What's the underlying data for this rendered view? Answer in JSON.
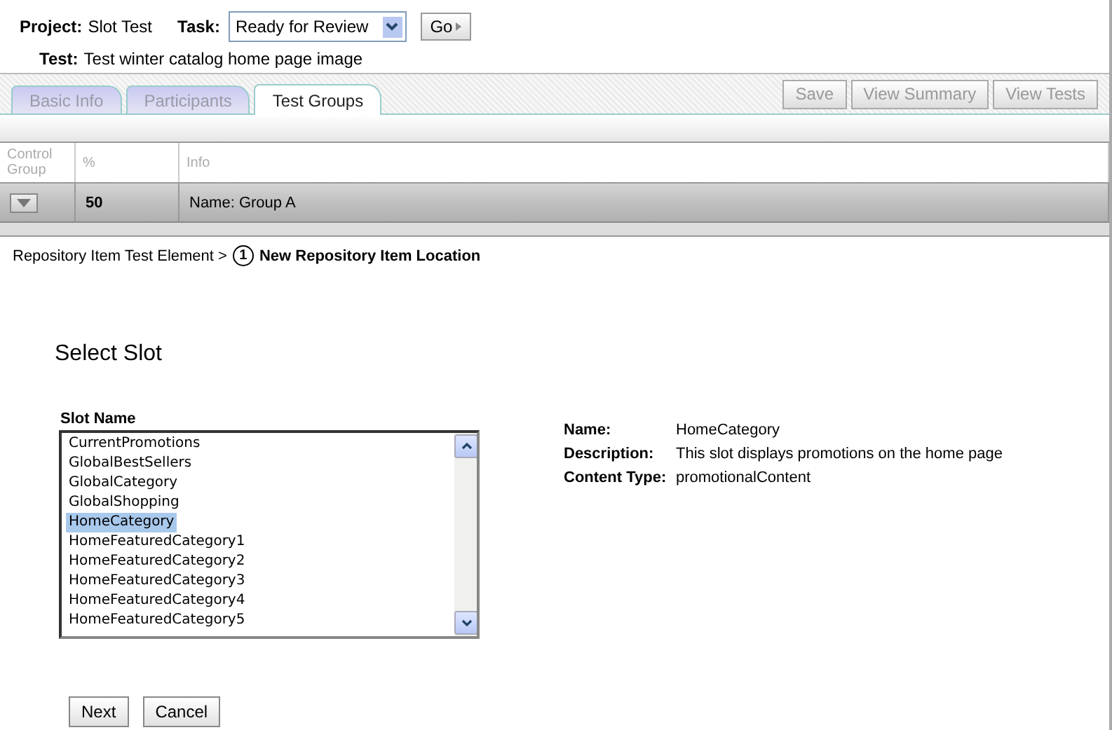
{
  "header": {
    "project_label": "Project:",
    "project": "Slot Test",
    "task_label": "Task:",
    "task": "Ready for Review",
    "go": "Go",
    "test_label": "Test:",
    "test": "Test winter catalog home page image"
  },
  "tabs": [
    {
      "label": "Basic Info",
      "selected": false
    },
    {
      "label": "Participants",
      "selected": false
    },
    {
      "label": "Test Groups",
      "selected": true
    }
  ],
  "actions": [
    {
      "label": "Save",
      "disabled": true
    },
    {
      "label": "View Summary",
      "disabled": true
    },
    {
      "label": "View Tests",
      "disabled": true
    }
  ],
  "table": {
    "columns": [
      "Control Group",
      "%",
      "Info"
    ],
    "rows": [
      {
        "percent": "50",
        "info": "Name: Group A"
      }
    ]
  },
  "breadcrumb": {
    "parent": "Repository Item Test Element >",
    "step": "1",
    "current": "New Repository Item Location"
  },
  "heading": "Select Slot",
  "slot_list": {
    "label": "Slot Name",
    "items": [
      {
        "label": "CurrentPromotions",
        "selected": false
      },
      {
        "label": "GlobalBestSellers",
        "selected": false
      },
      {
        "label": "GlobalCategory",
        "selected": false
      },
      {
        "label": "GlobalShopping",
        "selected": false
      },
      {
        "label": "HomeCategory",
        "selected": true
      },
      {
        "label": "HomeFeaturedCategory1",
        "selected": false
      },
      {
        "label": "HomeFeaturedCategory2",
        "selected": false
      },
      {
        "label": "HomeFeaturedCategory3",
        "selected": false
      },
      {
        "label": "HomeFeaturedCategory4",
        "selected": false
      },
      {
        "label": "HomeFeaturedCategory5",
        "selected": false
      }
    ]
  },
  "details": [
    {
      "label": "Name:",
      "value": "HomeCategory"
    },
    {
      "label": "Description:",
      "value": "This slot displays promotions on the home page"
    },
    {
      "label": "Content Type:",
      "value": "promotionalContent"
    }
  ],
  "buttons": [
    "Next",
    "Cancel"
  ]
}
